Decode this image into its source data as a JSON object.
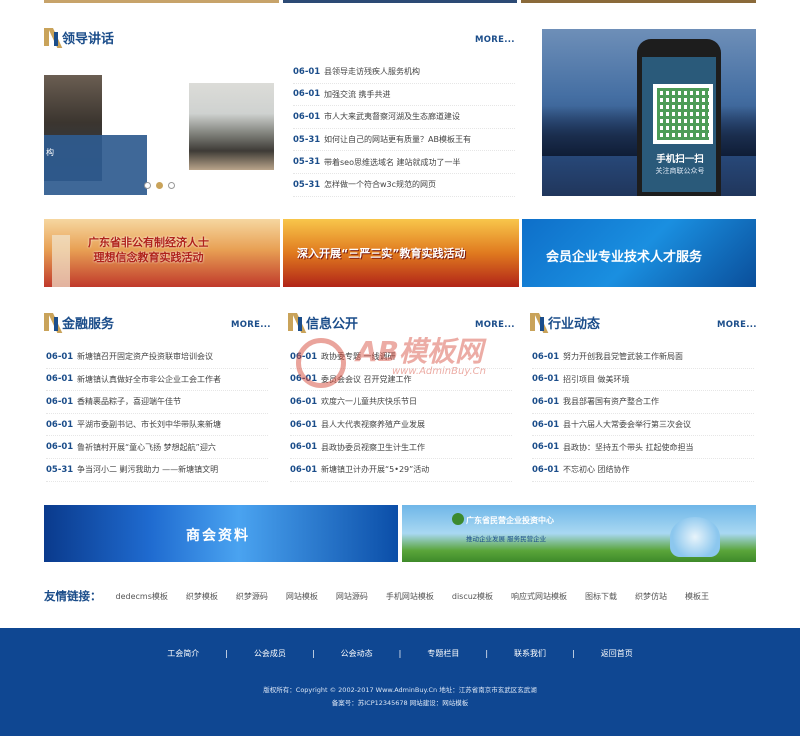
{
  "colors": {
    "brand": "#1b4d8a",
    "gold": "#c9a35a",
    "footer_bg": "#0f4792"
  },
  "sections": {
    "leader": {
      "title": "领导讲话",
      "more": "MORE...",
      "slider_caption": "构",
      "news": [
        {
          "date": "06-01",
          "title": "县领导走访残疾人服务机构"
        },
        {
          "date": "06-01",
          "title": "加强交流 携手共进"
        },
        {
          "date": "06-01",
          "title": "市人大来武夷督察河湖及生态廊道建设"
        },
        {
          "date": "05-31",
          "title": "如何让自己的网站更有质量？AB模板王有"
        },
        {
          "date": "05-31",
          "title": "带着seo思维选域名 建站就成功了一半"
        },
        {
          "date": "05-31",
          "title": "怎样做一个符合w3c规范的网页"
        }
      ]
    },
    "finance": {
      "title": "金融服务",
      "more": "MORE...",
      "news": [
        {
          "date": "06-01",
          "title": "新塘镇召开固定资产投资联审培训会议"
        },
        {
          "date": "06-01",
          "title": "新塘镇认真做好全市非公企业工会工作者"
        },
        {
          "date": "06-01",
          "title": "香精裹品粽子，喜迎端午佳节"
        },
        {
          "date": "06-01",
          "title": "平湖市委副书记、市长刘中华带队来新塘"
        },
        {
          "date": "06-01",
          "title": "鲁祈镇村开展“童心飞扬 梦想起航”迎六"
        },
        {
          "date": "05-31",
          "title": "争当河小二 剿污我助力 ——新塘镇文明"
        }
      ]
    },
    "info": {
      "title": "信息公开",
      "more": "MORE...",
      "news": [
        {
          "date": "06-01",
          "title": "政协委专题 一线调研"
        },
        {
          "date": "06-01",
          "title": "委员会会议 召开党建工作"
        },
        {
          "date": "06-01",
          "title": "欢度六一儿童共庆快乐节日"
        },
        {
          "date": "06-01",
          "title": "县人大代表视察养殖产业发展"
        },
        {
          "date": "06-01",
          "title": "县政协委员视察卫生计生工作"
        },
        {
          "date": "06-01",
          "title": "新塘镇卫计办开展“5•29”活动"
        }
      ]
    },
    "industry": {
      "title": "行业动态",
      "more": "MORE...",
      "news": [
        {
          "date": "06-01",
          "title": "努力开创我县党管武装工作新局面"
        },
        {
          "date": "06-01",
          "title": "招引项目 做美环境"
        },
        {
          "date": "06-01",
          "title": "我县部署国有资产整合工作"
        },
        {
          "date": "06-01",
          "title": "县十六届人大常委会举行第三次会议"
        },
        {
          "date": "06-01",
          "title": "县政协：坚持五个带头 扛起使命担当"
        },
        {
          "date": "06-01",
          "title": "不忘初心 团结协作"
        }
      ]
    }
  },
  "phone_ad": {
    "line1": "手机扫一扫",
    "line2": "关注商联公众号"
  },
  "banners": {
    "b1": "广东省非公有制经济人士\n理想信念教育实践活动",
    "b2": "深入开展“三严三实”教育实践活动",
    "b3": "会员企业专业技术人才服务",
    "bb1": "商会资料",
    "bb2_title": "广东省民营企业投资中心",
    "bb2_sub": "推动企业发展 服务民营企业"
  },
  "watermark": {
    "big": "AB模板网",
    "small": "www.AdminBuy.Cn"
  },
  "friends": {
    "label": "友情链接：",
    "links": [
      "dedecms模板",
      "织梦模板",
      "织梦源码",
      "网站模板",
      "网站源码",
      "手机网站模板",
      "discuz模板",
      "响应式网站模板",
      "图标下载",
      "织梦仿站",
      "模板王"
    ]
  },
  "footer": {
    "nav": [
      "工会简介",
      "公会成员",
      "公会动态",
      "专题栏目",
      "联系我们",
      "返回首页"
    ],
    "line1": "版权所有：Copyright © 2002-2017 Www.AdminBuy.Cn  地址：江苏省南京市玄武区玄武湖",
    "line2": "备案号：苏ICP12345678  网站建设：网站模板"
  }
}
